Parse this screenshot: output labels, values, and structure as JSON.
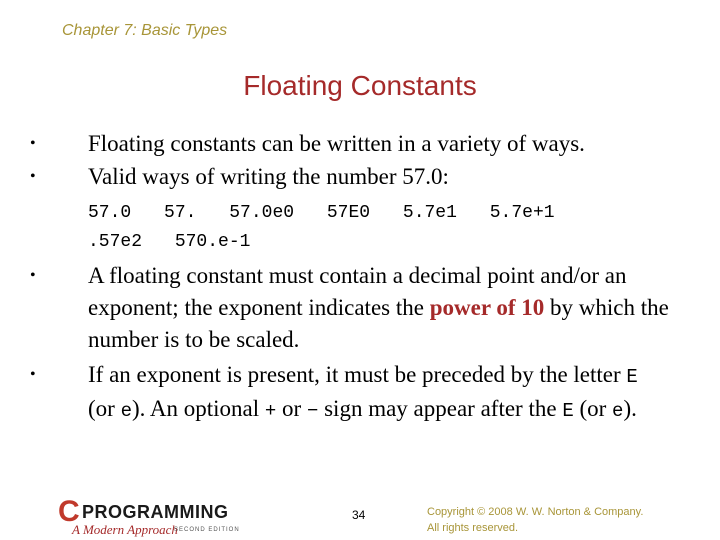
{
  "header": {
    "chapter": "Chapter 7: Basic Types",
    "title": "Floating Constants"
  },
  "bullets": {
    "b1": "Floating constants can be written in a variety of ways.",
    "b2": "Valid ways of writing the number 57.0:",
    "b3": {
      "pre": "A floating constant must contain a decimal point and/or an exponent; the exponent indicates the ",
      "highlight": "power of 10",
      "post": " by which the number is to be scaled."
    },
    "b4": {
      "t1": "If an exponent is present, it must be preceded by the letter ",
      "c1": "E",
      "t2": " (or ",
      "c2": "e",
      "t3": "). An optional ",
      "c3": "+",
      "t4": " or ",
      "c4": "−",
      "t5": " sign may appear after the ",
      "c5": "E",
      "t6": " (or ",
      "c6": "e",
      "t7": ")."
    },
    "bullet_char": "•"
  },
  "examples": {
    "row1": [
      "57.0",
      "57.",
      "57.0e0",
      "57E0",
      "5.7e1",
      "5.7e+1"
    ],
    "row2": [
      ".57e2",
      "570.e-1"
    ]
  },
  "footer": {
    "logo_letter": "C",
    "logo_word": "PROGRAMMING",
    "logo_subtitle": "A Modern Approach",
    "logo_edition": "SECOND EDITION",
    "page_number": "34",
    "copyright_line1": "Copyright © 2008 W. W. Norton & Company.",
    "copyright_line2": "All rights reserved."
  },
  "colors": {
    "title": "#a52a2a",
    "chapter": "#a89538",
    "highlight": "#a52a2a"
  }
}
